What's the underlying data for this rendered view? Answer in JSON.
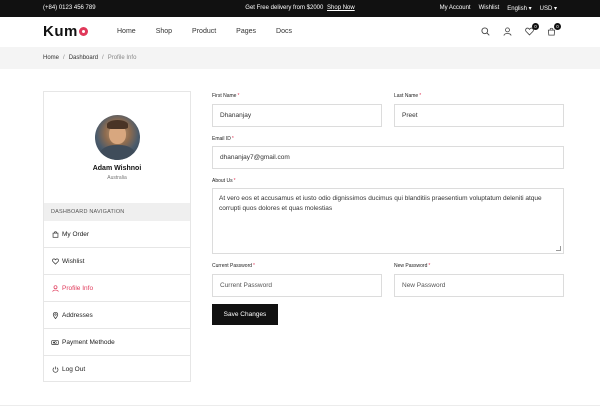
{
  "topbar": {
    "phone": "(+84) 0123 456 789",
    "promo_text": "Get Free delivery from $2000",
    "promo_link": "Shop Now",
    "account": "My Account",
    "wishlist": "Wishlist",
    "language": "English",
    "currency": "USD"
  },
  "header": {
    "logo": "Kum",
    "nav": [
      "Home",
      "Shop",
      "Product",
      "Pages",
      "Docs"
    ],
    "wishlist_count": "0",
    "cart_count": "0"
  },
  "breadcrumb": {
    "items": [
      "Home",
      "Dashboard",
      "Profile Info"
    ]
  },
  "sidebar": {
    "name": "Adam Wishnoi",
    "country": "Australia",
    "nav_heading": "DASHBOARD NAVIGATION",
    "items": [
      {
        "label": "My Order",
        "icon": "bag-icon"
      },
      {
        "label": "Wishlist",
        "icon": "heart-icon"
      },
      {
        "label": "Profile Info",
        "icon": "user-icon"
      },
      {
        "label": "Addresses",
        "icon": "location-icon"
      },
      {
        "label": "Payment Methode",
        "icon": "card-icon"
      },
      {
        "label": "Log Out",
        "icon": "power-icon"
      }
    ]
  },
  "form": {
    "first_name_label": "First Name",
    "first_name": "Dhananjay",
    "last_name_label": "Last Name",
    "last_name": "Preet",
    "email_label": "Email ID",
    "email": "dhananjay7@gmail.com",
    "about_label": "About Us",
    "about": "At vero eos et accusamus et iusto odio dignissimos ducimus qui blanditiis praesentium voluptatum deleniti atque corrupti quos dolores et quas molestias",
    "current_password_label": "Current Password",
    "current_password_placeholder": "Current Password",
    "new_password_label": "New Password",
    "new_password_placeholder": "New Password",
    "save_label": "Save Changes"
  },
  "colors": {
    "accent": "#e0395a",
    "dark": "#111111"
  }
}
